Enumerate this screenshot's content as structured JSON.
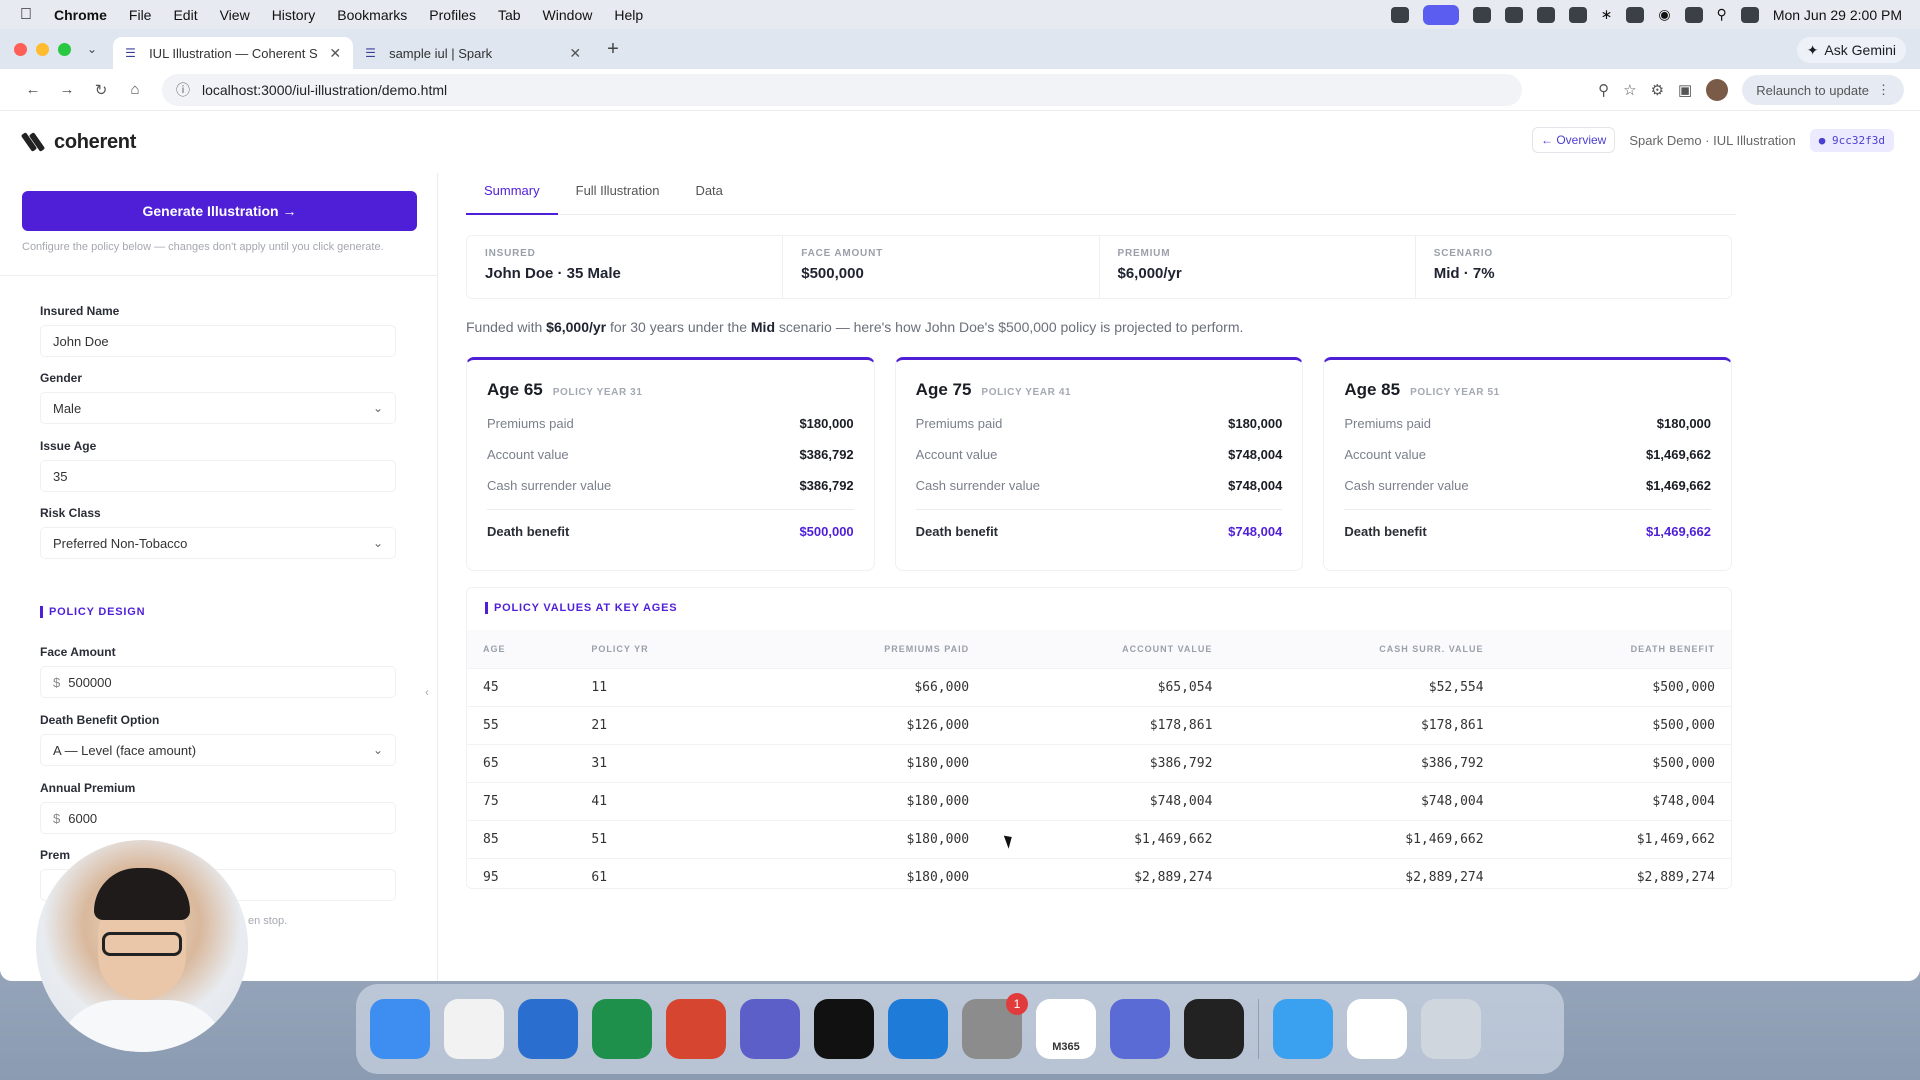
{
  "menubar": {
    "app": "Chrome",
    "items": [
      "File",
      "Edit",
      "View",
      "History",
      "Bookmarks",
      "Profiles",
      "Tab",
      "Window",
      "Help"
    ],
    "clock": "Mon Jun 29  2:00 PM"
  },
  "browser": {
    "tabs": [
      {
        "title": "IUL Illustration — Coherent S"
      },
      {
        "title": "sample iul | Spark"
      }
    ],
    "ask_gemini": "Ask Gemini",
    "url": "localhost:3000/iul-illustration/demo.html",
    "relaunch": "Relaunch to update"
  },
  "app": {
    "logo": "coherent",
    "overview": "← Overview",
    "crumb": "Spark Demo · IUL Illustration",
    "hash": "● 9cc32f3d"
  },
  "sidebar": {
    "generate_button": "Generate Illustration  →",
    "hint": "Configure the policy below — changes don't apply until you click generate.",
    "fields": {
      "insured_name_label": "Insured Name",
      "insured_name_value": "John Doe",
      "gender_label": "Gender",
      "gender_value": "Male",
      "issue_age_label": "Issue Age",
      "issue_age_value": "35",
      "risk_class_label": "Risk Class",
      "risk_class_value": "Preferred Non-Tobacco"
    },
    "policy_design_tag": "POLICY DESIGN",
    "policy": {
      "face_amount_label": "Face Amount",
      "currency": "$",
      "face_amount_value": "500000",
      "dbo_label": "Death Benefit Option",
      "dbo_value": "A — Level (face amount)",
      "premium_label": "Annual Premium",
      "premium_value": "6000",
      "next_label_partial": "Prem",
      "hint_partial": "en stop."
    }
  },
  "main": {
    "tabs": [
      "Summary",
      "Full Illustration",
      "Data"
    ],
    "summary": [
      {
        "k": "INSURED",
        "v": "John Doe · 35 Male"
      },
      {
        "k": "FACE AMOUNT",
        "v": "$500,000"
      },
      {
        "k": "PREMIUM",
        "v": "$6,000/yr"
      },
      {
        "k": "SCENARIO",
        "v": "Mid · 7%"
      }
    ],
    "funded": {
      "p1": "Funded with ",
      "b1": "$6,000/yr",
      "p2": " for 30 years under the ",
      "b2": "Mid",
      "p3": " scenario — here's how John Doe's $500,000 policy is projected to perform."
    },
    "row_labels": {
      "premiums": "Premiums paid",
      "account": "Account value",
      "csv": "Cash surrender value",
      "db": "Death benefit"
    },
    "cards": [
      {
        "age": "Age 65",
        "py": "POLICY YEAR 31",
        "premiums": "$180,000",
        "account": "$386,792",
        "csv": "$386,792",
        "db": "$500,000"
      },
      {
        "age": "Age 75",
        "py": "POLICY YEAR 41",
        "premiums": "$180,000",
        "account": "$748,004",
        "csv": "$748,004",
        "db": "$748,004"
      },
      {
        "age": "Age 85",
        "py": "POLICY YEAR 51",
        "premiums": "$180,000",
        "account": "$1,469,662",
        "csv": "$1,469,662",
        "db": "$1,469,662"
      }
    ],
    "table_title": "POLICY VALUES AT KEY AGES",
    "table_headers": [
      "AGE",
      "POLICY YR",
      "PREMIUMS PAID",
      "ACCOUNT VALUE",
      "CASH SURR. VALUE",
      "DEATH BENEFIT"
    ],
    "table_rows": [
      [
        "45",
        "11",
        "$66,000",
        "$65,054",
        "$52,554",
        "$500,000"
      ],
      [
        "55",
        "21",
        "$126,000",
        "$178,861",
        "$178,861",
        "$500,000"
      ],
      [
        "65",
        "31",
        "$180,000",
        "$386,792",
        "$386,792",
        "$500,000"
      ],
      [
        "75",
        "41",
        "$180,000",
        "$748,004",
        "$748,004",
        "$748,004"
      ],
      [
        "85",
        "51",
        "$180,000",
        "$1,469,662",
        "$1,469,662",
        "$1,469,662"
      ],
      [
        "95",
        "61",
        "$180,000",
        "$2,889,274",
        "$2,889,274",
        "$2,889,274"
      ]
    ]
  },
  "dock": {
    "apps": [
      "finder-icon",
      "chrome-icon",
      "outlook-icon",
      "excel-icon",
      "powerpoint-icon",
      "teams-icon",
      "chatgpt-icon",
      "vscode-icon",
      "system-settings-icon",
      "m365-icon",
      "mic-app-icon",
      "obs-icon",
      "quicktime-icon",
      "files-icon",
      "trash-icon"
    ],
    "settings_badge": "1",
    "m365_label": "M365",
    "colors": [
      "#3d8ef0",
      "#f2f2f2",
      "#2a6fd0",
      "#1f8f4c",
      "#d6452f",
      "#5b5fc7",
      "#111111",
      "#1f7bd8",
      "#8c8c8c",
      "#ffffff",
      "#5a6bd6",
      "#222222",
      "#3aa0f0",
      "#ffffff",
      "#d0d6de"
    ]
  }
}
